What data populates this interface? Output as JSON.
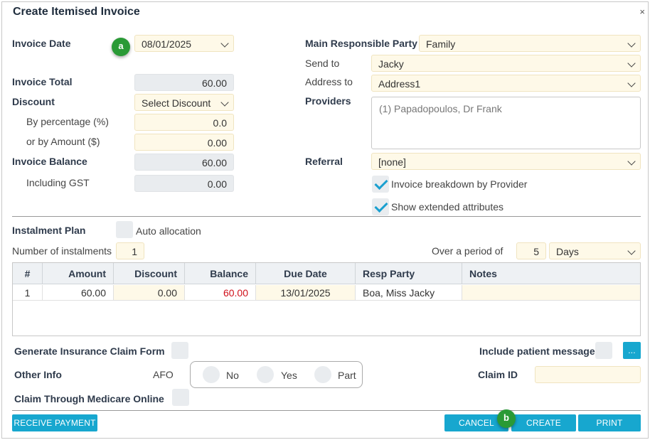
{
  "dialog": {
    "title": "Create Itemised Invoice",
    "close_glyph": "×"
  },
  "left": {
    "invoice_date_label": "Invoice Date",
    "invoice_date_value": "08/01/2025",
    "invoice_total_label": "Invoice Total",
    "invoice_total_value": "60.00",
    "discount_label": "Discount",
    "discount_select": "Select Discount",
    "by_percentage_label": "By percentage (%)",
    "by_percentage_value": "0.0",
    "by_amount_label": "or by Amount ($)",
    "by_amount_value": "0.00",
    "invoice_balance_label": "Invoice Balance",
    "invoice_balance_value": "60.00",
    "including_gst_label": "Including GST",
    "including_gst_value": "0.00"
  },
  "right": {
    "main_party_label": "Main Responsible Party",
    "main_party_value": "Family",
    "send_to_label": "Send to",
    "send_to_value": "Jacky",
    "address_to_label": "Address to",
    "address_to_value": "Address1",
    "providers_label": "Providers",
    "providers_value": "(1) Papadopoulos, Dr Frank",
    "referral_label": "Referral",
    "referral_value": "[none]",
    "breakdown_label": "Invoice breakdown by Provider",
    "extended_label": "Show extended attributes"
  },
  "instalment": {
    "plan_label": "Instalment Plan",
    "auto_label": "Auto allocation",
    "count_label": "Number of instalments",
    "count_value": "1",
    "period_label": "Over a period of",
    "period_value": "5",
    "period_unit": "Days"
  },
  "table": {
    "headers": [
      "#",
      "Amount",
      "Discount",
      "Balance",
      "Due Date",
      "Resp Party",
      "Notes"
    ],
    "rows": [
      {
        "num": "1",
        "amount": "60.00",
        "discount": "0.00",
        "balance": "60.00",
        "due": "13/01/2025",
        "party": "Boa, Miss Jacky",
        "notes": ""
      }
    ]
  },
  "bottom": {
    "insurance_label": "Generate Insurance Claim Form",
    "patient_msg_label": "Include patient message",
    "ellipsis": "...",
    "other_info_label": "Other Info",
    "afo_label": "AFO",
    "radio_no": "No",
    "radio_yes": "Yes",
    "radio_part": "Part",
    "claim_id_label": "Claim ID",
    "medicare_label": "Claim Through Medicare Online"
  },
  "buttons": {
    "receive_payment": "RECEIVE PAYMENT",
    "cancel": "CANCEL",
    "create": "CREATE",
    "print": "PRINT"
  },
  "markers": {
    "a": "a",
    "b": "b"
  },
  "colors": {
    "accent": "#17a7cf",
    "marker": "#2a9a36",
    "field_yellow": "#fef9e8",
    "field_grey": "#e9ecef",
    "negative": "#d0101a"
  }
}
